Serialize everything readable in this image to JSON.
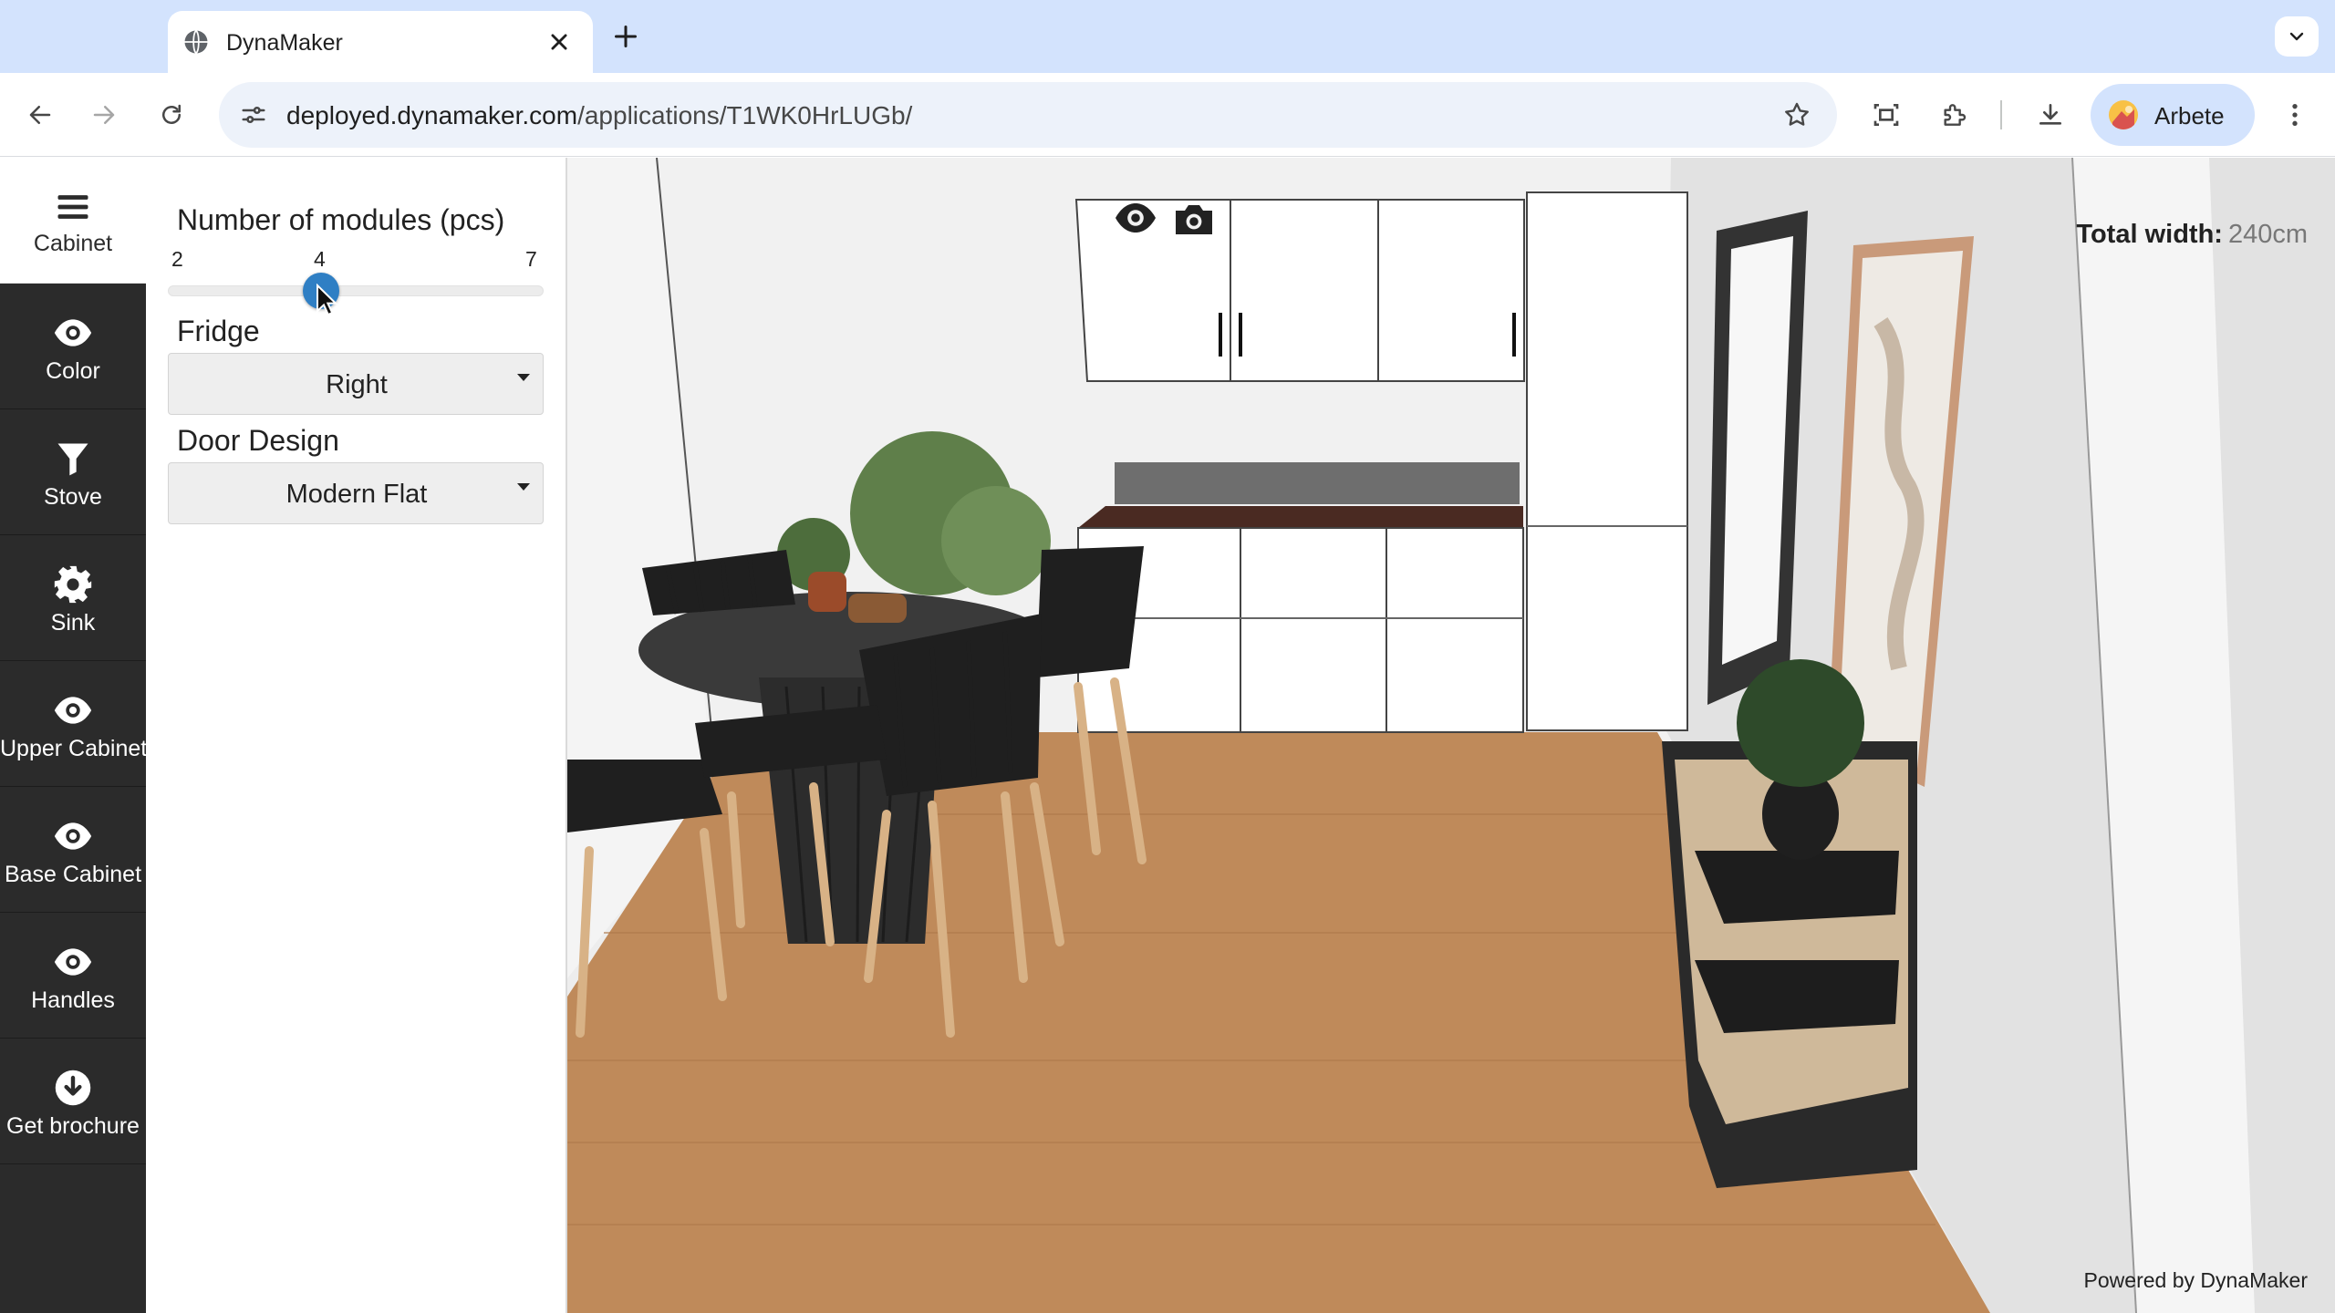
{
  "browser": {
    "tab_title": "DynaMaker",
    "url_host": "deployed.dynamaker.com",
    "url_path": "/applications/T1WK0HrLUGb/",
    "profile_label": "Arbete"
  },
  "sidebar": {
    "items": [
      {
        "label": "Cabinet",
        "icon": "menu-icon",
        "active": true
      },
      {
        "label": "Color",
        "icon": "eye-icon",
        "active": false
      },
      {
        "label": "Stove",
        "icon": "funnel-icon",
        "active": false
      },
      {
        "label": "Sink",
        "icon": "gear-icon",
        "active": false
      },
      {
        "label": "Upper Cabinet",
        "icon": "eye-icon",
        "active": false
      },
      {
        "label": "Base Cabinet",
        "icon": "eye-icon",
        "active": false
      },
      {
        "label": "Handles",
        "icon": "eye-icon",
        "active": false
      },
      {
        "label": "Get brochure",
        "icon": "download-circle-icon",
        "active": false
      }
    ]
  },
  "panel": {
    "modules": {
      "label": "Number of modules (pcs)",
      "min": "2",
      "value": "4",
      "max": "7",
      "fraction": 0.4
    },
    "fridge": {
      "label": "Fridge",
      "value": "Right"
    },
    "door_design": {
      "label": "Door Design",
      "value": "Modern Flat"
    }
  },
  "viewport": {
    "total_width_label": "Total width:",
    "total_width_value": "240cm",
    "powered_by": "Powered by DynaMaker"
  },
  "colors": {
    "accent": "#2f7fc4",
    "sidebar_bg": "#2b2b2b",
    "floor": "#bf8a5a",
    "countertop": "#4a2a22"
  }
}
